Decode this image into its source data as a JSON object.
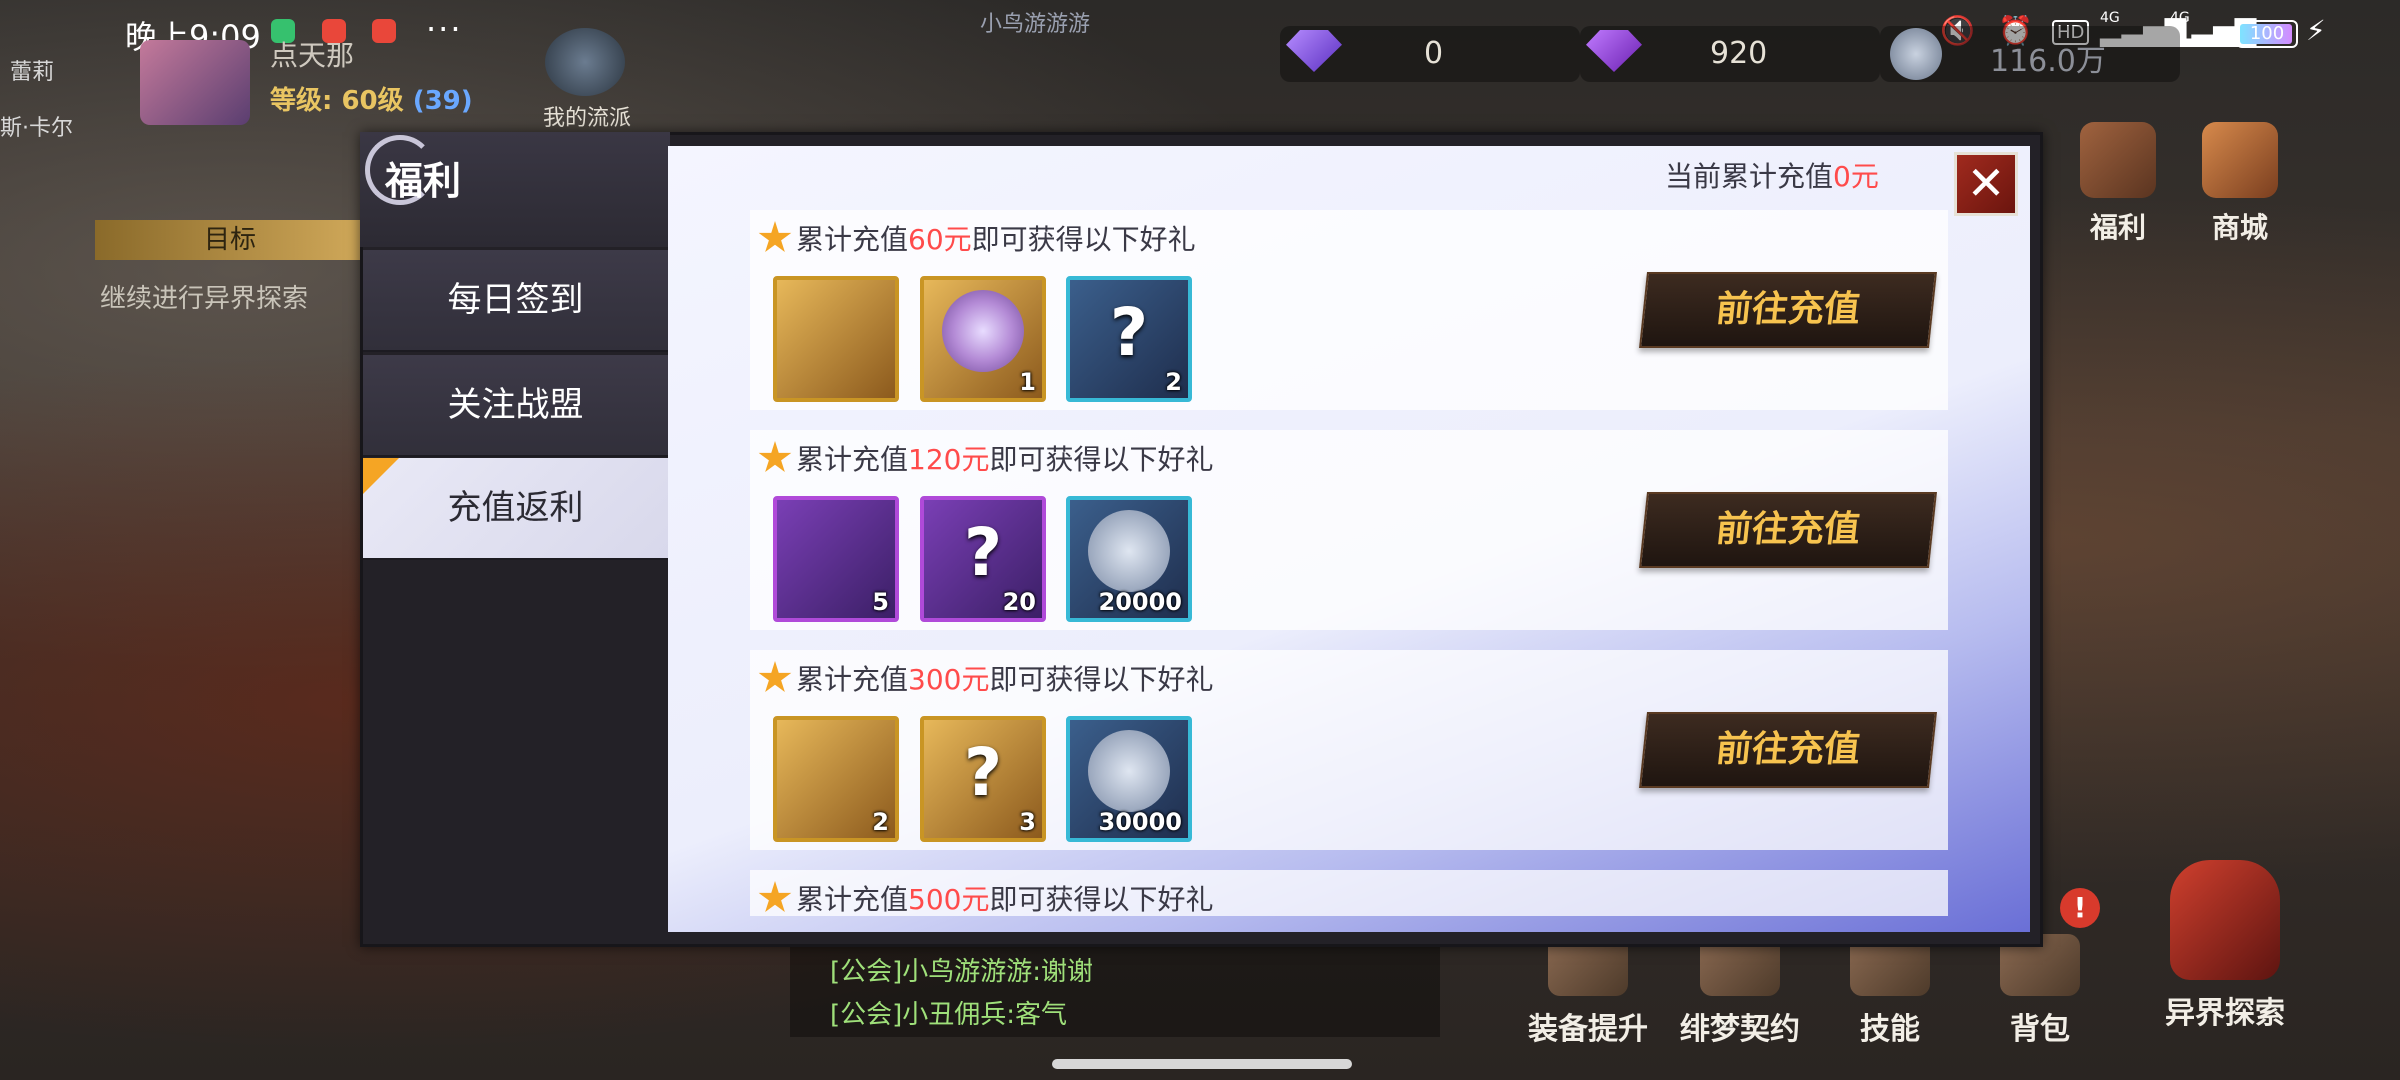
{
  "status_bar": {
    "time": "晚上9:09",
    "more": "···",
    "network_1": "4G",
    "network_2": "4G",
    "hd": "HD",
    "battery": "100"
  },
  "hud": {
    "player_name": "点天那",
    "level_label": "等级: 60级",
    "level_sub": "(39)",
    "my_style": "我的流派",
    "currencies": [
      "0",
      "920",
      "116.0万"
    ],
    "top_center": "小鸟游游游"
  },
  "quest": {
    "tab": "目标",
    "text": "继续进行异界探索"
  },
  "side_names": [
    "蕾莉",
    "斯·卡尔"
  ],
  "right_buttons": [
    {
      "label": "福利",
      "icon": "gift-box-icon"
    },
    {
      "label": "商城",
      "icon": "shop-icon"
    }
  ],
  "bottom_buttons": [
    {
      "label": "装备提升",
      "icon": "anvil-icon"
    },
    {
      "label": "绯梦契约",
      "icon": "contract-icon"
    },
    {
      "label": "技能",
      "icon": "skill-book-icon"
    },
    {
      "label": "背包",
      "icon": "backpack-icon"
    },
    {
      "label": "异界探索",
      "icon": "demon-helmet-icon"
    }
  ],
  "chat": [
    "[公会]小鸟游游游:谢谢",
    "[公会]小丑佣兵:客气"
  ],
  "dialog": {
    "title": "福利",
    "tabs": [
      "每日签到",
      "关注战盟",
      "充值返利"
    ],
    "active_tab": "充值返利",
    "current_label": "当前累计充值",
    "current_value": "0元",
    "close": "✕",
    "tiers": [
      {
        "prefix": "累计充值",
        "amount": "60元",
        "suffix": "即可获得以下好礼",
        "button": "前往充值",
        "items": [
          {
            "name": "armor-piece-icon",
            "rarity": "gold",
            "glyph": "",
            "count": ""
          },
          {
            "name": "portrait-coin-icon",
            "rarity": "gold",
            "glyph": "",
            "count": "1"
          },
          {
            "name": "mystery-item-icon",
            "rarity": "blue",
            "glyph": "?",
            "count": "2"
          }
        ]
      },
      {
        "prefix": "累计充值",
        "amount": "120元",
        "suffix": "即可获得以下好礼",
        "button": "前往充值",
        "items": [
          {
            "name": "treasure-chest-icon",
            "rarity": "purple",
            "glyph": "",
            "count": "5"
          },
          {
            "name": "mystery-item-icon",
            "rarity": "purple",
            "glyph": "?",
            "count": "20"
          },
          {
            "name": "silver-coin-icon",
            "rarity": "blue",
            "glyph": "",
            "count": "20000"
          }
        ]
      },
      {
        "prefix": "累计充值",
        "amount": "300元",
        "suffix": "即可获得以下好礼",
        "button": "前往充值",
        "items": [
          {
            "name": "winged-pet-icon",
            "rarity": "gold",
            "glyph": "",
            "count": "2"
          },
          {
            "name": "mystery-item-icon",
            "rarity": "gold",
            "glyph": "?",
            "count": "3"
          },
          {
            "name": "silver-coin-icon",
            "rarity": "blue",
            "glyph": "",
            "count": "30000"
          }
        ]
      },
      {
        "prefix": "累计充值",
        "amount": "500元",
        "suffix": "即可获得以下好礼",
        "button": "",
        "items": []
      }
    ]
  }
}
